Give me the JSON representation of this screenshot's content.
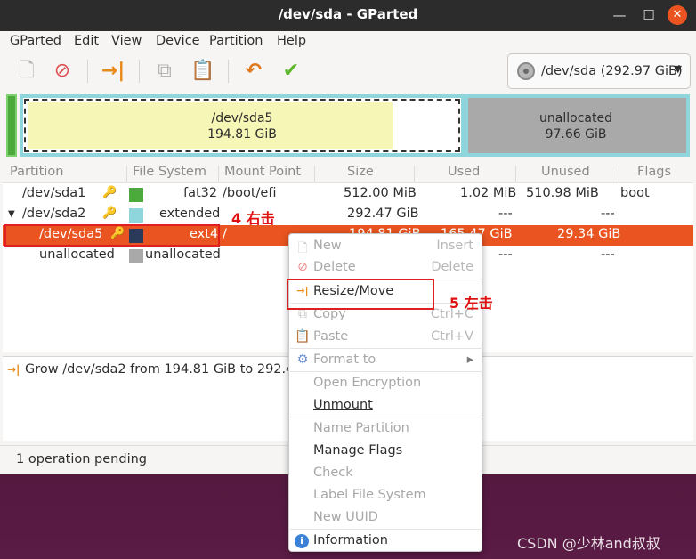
{
  "window": {
    "title": "/dev/sda - GParted"
  },
  "menubar": [
    "GParted",
    "Edit",
    "View",
    "Device",
    "Partition",
    "Help"
  ],
  "toolbar": {
    "buttons": [
      "new-icon",
      "delete-icon",
      "resize-move-icon",
      "copy-icon",
      "paste-icon",
      "undo-icon",
      "apply-icon"
    ]
  },
  "device_selector": {
    "label": "/dev/sda (292.97 GiB)"
  },
  "disk_map": {
    "sda5": {
      "name": "/dev/sda5",
      "size": "194.81 GiB"
    },
    "unallocated": {
      "name": "unallocated",
      "size": "97.66 GiB"
    }
  },
  "table": {
    "headers": [
      "Partition",
      "File System",
      "Mount Point",
      "Size",
      "Used",
      "Unused",
      "Flags"
    ],
    "rows": [
      {
        "partition": "/dev/sda1",
        "filesystem": "fat32",
        "mount": "/boot/efi",
        "size": "512.00 MiB",
        "used": "1.02 MiB",
        "unused": "510.98 MiB",
        "flags": "boot",
        "color": "#4caa3c"
      },
      {
        "partition": "/dev/sda2",
        "filesystem": "extended",
        "mount": "",
        "size": "292.47 GiB",
        "used": "---",
        "unused": "---",
        "flags": "",
        "color": "#8fd6dc"
      },
      {
        "partition": "/dev/sda5",
        "filesystem": "ext4",
        "mount": "/",
        "size": "194.81 GiB",
        "used": "165.47 GiB",
        "unused": "29.34 GiB",
        "flags": "",
        "color": "#2b3a5a"
      },
      {
        "partition": "unallocated",
        "filesystem": "unallocated",
        "mount": "",
        "size": "",
        "used": "---",
        "unused": "---",
        "flags": "",
        "color": "#a9a9a9"
      }
    ]
  },
  "operations": [
    "Grow /dev/sda2 from 194.81 GiB to 292.47 GiB"
  ],
  "status": "1 operation pending",
  "annotations": {
    "step4": "4 右击",
    "step5": "5 左击"
  },
  "context_menu": {
    "items": [
      {
        "label": "New",
        "accel": "Insert",
        "disabled": true,
        "icon": "new-icon"
      },
      {
        "label": "Delete",
        "accel": "Delete",
        "disabled": true,
        "icon": "delete-icon"
      },
      {
        "label": "Resize/Move",
        "accel": "",
        "disabled": false,
        "icon": "resize-move-icon"
      },
      {
        "label": "Copy",
        "accel": "Ctrl+C",
        "disabled": true,
        "icon": "copy-icon"
      },
      {
        "label": "Paste",
        "accel": "Ctrl+V",
        "disabled": true,
        "icon": "paste-icon"
      },
      {
        "label": "Format to",
        "accel": "",
        "disabled": true,
        "icon": "format-icon"
      },
      {
        "label": "Open Encryption",
        "accel": "",
        "disabled": true,
        "icon": ""
      },
      {
        "label": "Unmount",
        "accel": "",
        "disabled": false,
        "icon": ""
      },
      {
        "label": "Name Partition",
        "accel": "",
        "disabled": true,
        "icon": ""
      },
      {
        "label": "Manage Flags",
        "accel": "",
        "disabled": false,
        "icon": ""
      },
      {
        "label": "Check",
        "accel": "",
        "disabled": true,
        "icon": ""
      },
      {
        "label": "Label File System",
        "accel": "",
        "disabled": true,
        "icon": ""
      },
      {
        "label": "New UUID",
        "accel": "",
        "disabled": true,
        "icon": ""
      },
      {
        "label": "Information",
        "accel": "",
        "disabled": false,
        "icon": "information-icon"
      }
    ]
  },
  "watermark": "CSDN @少林and叔叔",
  "colors": {
    "accent": "#e95420",
    "annotation": "#e02020"
  }
}
